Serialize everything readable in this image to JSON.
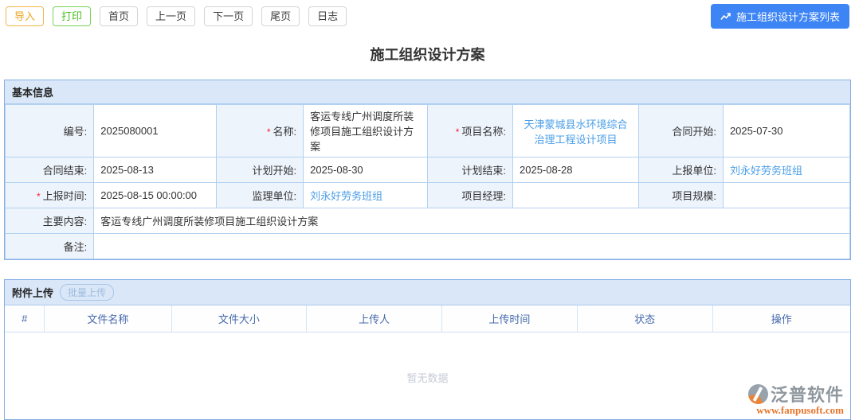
{
  "toolbar": {
    "import_label": "导入",
    "print_label": "打印",
    "first_label": "首页",
    "prev_label": "上一页",
    "next_label": "下一页",
    "last_label": "尾页",
    "log_label": "日志",
    "list_button_label": "施工组织设计方案列表"
  },
  "page": {
    "title": "施工组织设计方案"
  },
  "basic_info": {
    "section_title": "基本信息",
    "required_mark": "*",
    "rows": [
      {
        "cells": [
          {
            "label": "编号:",
            "value": "2025080001"
          },
          {
            "label": "名称:",
            "value": "客运专线广州调度所装修项目施工组织设计方案"
          },
          {
            "label": "项目名称:",
            "value": "天津蒙城县水环境综合治理工程设计项目"
          },
          {
            "label": "合同开始:",
            "value": "2025-07-30"
          }
        ]
      },
      {
        "cells": [
          {
            "label": "合同结束:",
            "value": "2025-08-13"
          },
          {
            "label": "计划开始:",
            "value": "2025-08-30"
          },
          {
            "label": "计划结束:",
            "value": "2025-08-28"
          },
          {
            "label": "上报单位:",
            "value": "刘永好劳务班组"
          }
        ]
      },
      {
        "cells": [
          {
            "label": "上报时间:",
            "value": "2025-08-15 00:00:00"
          },
          {
            "label": "监理单位:",
            "value": "刘永好劳务班组"
          },
          {
            "label": "项目经理:",
            "value": ""
          },
          {
            "label": "项目规模:",
            "value": ""
          }
        ]
      },
      {
        "cells": [
          {
            "label": "主要内容:",
            "value": "客运专线广州调度所装修项目施工组织设计方案"
          }
        ]
      },
      {
        "cells": [
          {
            "label": "备注:",
            "value": ""
          }
        ]
      }
    ]
  },
  "attachments": {
    "section_title": "附件上传",
    "batch_upload_label": "批量上传",
    "columns": [
      "#",
      "文件名称",
      "文件大小",
      "上传人",
      "上传时间",
      "状态",
      "操作"
    ],
    "rows": [],
    "empty_text": "暂无数据"
  },
  "branding": {
    "name": "泛普软件",
    "url": "www.fanpusoft.com"
  },
  "colors": {
    "primary_blue": "#3d84f5",
    "link_blue": "#4a9ee8",
    "section_header_bg": "#d9e7f8",
    "section_border": "#85afe2",
    "grid_border": "#b3d1f0",
    "label_cell_bg": "#eef4fc",
    "table_header_text": "#4468ad",
    "import_orange": "#efa523",
    "print_green": "#47bf1d",
    "required_red": "#f5222d",
    "logo_orange": "#e8762c",
    "empty_text_gray": "#c5cad6"
  }
}
